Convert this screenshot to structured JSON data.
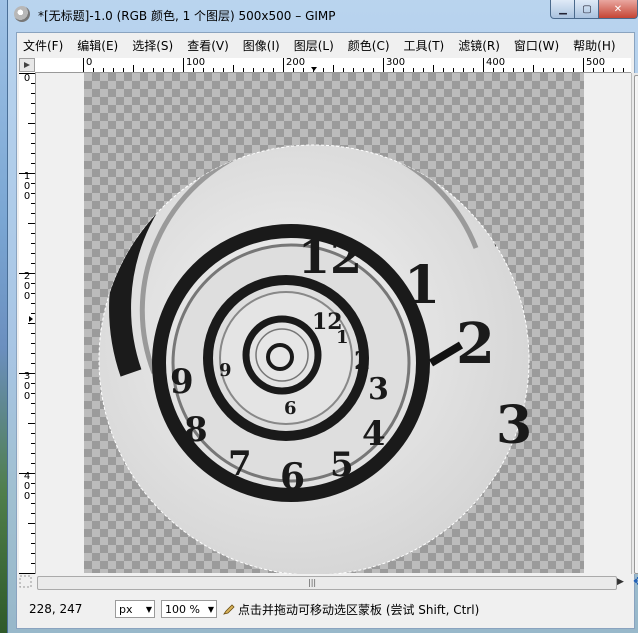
{
  "window": {
    "title": "*[无标题]-1.0 (RGB 颜色, 1 个图层) 500x500 – GIMP"
  },
  "menubar": [
    {
      "label": "文件(F)"
    },
    {
      "label": "编辑(E)"
    },
    {
      "label": "选择(S)"
    },
    {
      "label": "查看(V)"
    },
    {
      "label": "图像(I)"
    },
    {
      "label": "图层(L)"
    },
    {
      "label": "颜色(C)"
    },
    {
      "label": "工具(T)"
    },
    {
      "label": "滤镜(R)"
    },
    {
      "label": "窗口(W)"
    },
    {
      "label": "帮助(H)"
    }
  ],
  "hruler": {
    "labels": [
      "0",
      "100",
      "200",
      "300",
      "400",
      "500"
    ]
  },
  "vruler": {
    "labels": [
      "0",
      "100",
      "200",
      "300",
      "400"
    ]
  },
  "canvas": {
    "clock_numerals": [
      "12",
      "1",
      "2",
      "3",
      "9",
      "8",
      "7",
      "6",
      "5",
      "4"
    ]
  },
  "statusbar": {
    "coords": "228, 247",
    "unit": "px",
    "zoom": "100 %",
    "message": "点击并拖动可移动选区蒙板 (尝试 Shift, Ctrl)"
  }
}
